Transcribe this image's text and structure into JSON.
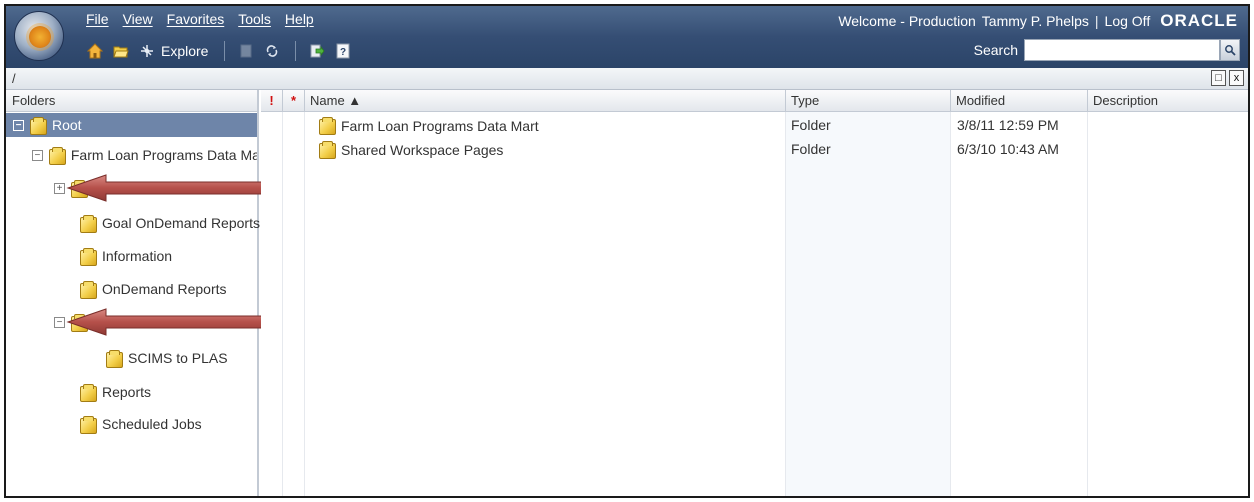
{
  "header": {
    "menu": [
      "File",
      "View",
      "Favorites",
      "Tools",
      "Help"
    ],
    "welcome": "Welcome - Production",
    "user": "Tammy P. Phelps",
    "separator": "|",
    "logoff": "Log Off",
    "brand": "ORACLE",
    "explore_label": "Explore",
    "search_label": "Search",
    "search_value": ""
  },
  "pathbar": {
    "path": "/"
  },
  "left_pane": {
    "title": "Folders",
    "tree": [
      {
        "label": "Root",
        "toggle": "−",
        "selected": true
      },
      {
        "label": "Farm Loan Programs Data Ma",
        "toggle": "−"
      },
      {
        "label": "",
        "toggle": "+"
      },
      {
        "label": "Goal OnDemand Reports"
      },
      {
        "label": "Information"
      },
      {
        "label": "OnDemand Reports"
      },
      {
        "label": "",
        "toggle": "−"
      },
      {
        "label": "SCIMS to PLAS"
      },
      {
        "label": "Reports"
      },
      {
        "label": "Scheduled Jobs"
      }
    ]
  },
  "right_pane": {
    "columns": {
      "priority": "!",
      "required": "*",
      "name": "Name ▲",
      "type": "Type",
      "modified": "Modified",
      "description": "Description"
    },
    "rows": [
      {
        "name": "Farm Loan Programs Data Mart",
        "type": "Folder",
        "modified": "3/8/11 12:59 PM",
        "description": ""
      },
      {
        "name": "Shared Workspace Pages",
        "type": "Folder",
        "modified": "6/3/10 10:43 AM",
        "description": ""
      }
    ]
  },
  "colors": {
    "header_top": "#4f6a8e",
    "header_bottom": "#2b4468",
    "selection": "#6e85a9",
    "arrow": "#b5504a",
    "priority_red": "#d01010"
  }
}
